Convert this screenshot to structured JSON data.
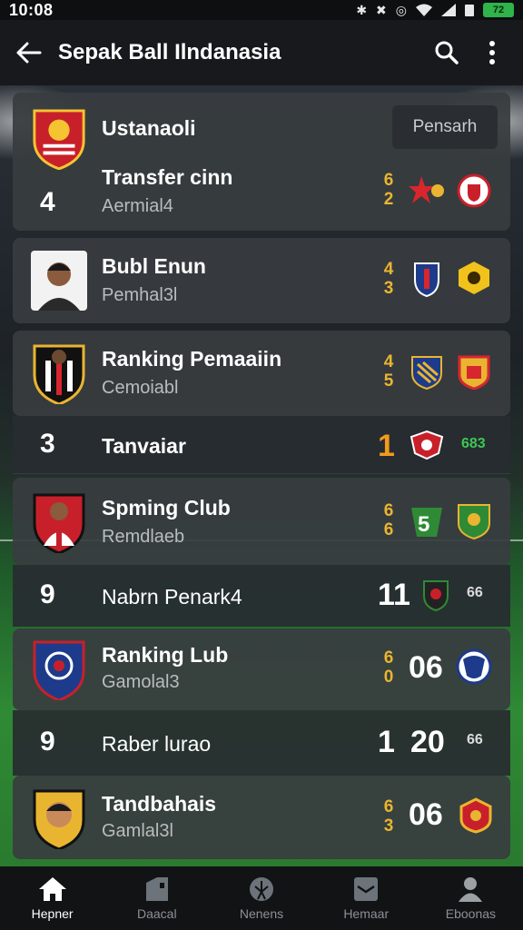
{
  "status_bar": {
    "time": "10:08",
    "battery_level": "72",
    "icons": [
      "bluetooth-icon",
      "mute-icon",
      "data-icon",
      "wifi-icon",
      "signal-icon",
      "sim-icon",
      "battery-icon"
    ]
  },
  "app_bar": {
    "title": "Sepak Ball Ilndanasia",
    "icons": [
      "back-arrow-icon",
      "search-icon",
      "more-vert-icon"
    ]
  },
  "header_card": {
    "title": "Ustanaoli",
    "search_button": "Pensarh"
  },
  "rows": [
    {
      "rank": "4",
      "name": "Transfer cinn",
      "subtitle": "Aermial4",
      "score_top": "6",
      "score_bottom": "2"
    },
    {
      "name": "Bubl Enun",
      "subtitle": "Pemhal3l",
      "score_top": "4",
      "score_bottom": "3"
    },
    {
      "name": "Ranking Pemaaiin",
      "subtitle": "Cemoiabl",
      "score_top": "4",
      "score_bottom": "5"
    },
    {
      "rank": "3",
      "name": "Tanvaiar",
      "value": "1",
      "mini_score": "683"
    },
    {
      "name": "Spming Club",
      "subtitle": "Remdlaeb",
      "score_top": "6",
      "score_bottom": "6"
    },
    {
      "rank": "9",
      "name": "Nabrn Penark4",
      "value": "11",
      "mini_score": "66"
    },
    {
      "name": "Ranking Lub",
      "subtitle": "Gamolal3",
      "score_top": "6",
      "score_bottom": "0",
      "value": "06"
    },
    {
      "rank": "9",
      "name": "Raber lurao",
      "value_left": "1",
      "value": "20",
      "mini_score": "66"
    },
    {
      "name": "Tandbahais",
      "subtitle": "Gamlal3l",
      "score_top": "6",
      "score_bottom": "3",
      "value": "06"
    }
  ],
  "bottom_nav": [
    {
      "label": "Hepner",
      "icon": "home-icon",
      "active": true
    },
    {
      "label": "Daacal",
      "icon": "building-icon",
      "active": false
    },
    {
      "label": "Nenens",
      "icon": "ball-icon",
      "active": false
    },
    {
      "label": "Hemaar",
      "icon": "inbox-icon",
      "active": false
    },
    {
      "label": "Eboonas",
      "icon": "person-icon",
      "active": false
    }
  ],
  "colors": {
    "accent_gold": "#e9b531",
    "accent_orange": "#f29a1c",
    "accent_green": "#3ec653"
  }
}
